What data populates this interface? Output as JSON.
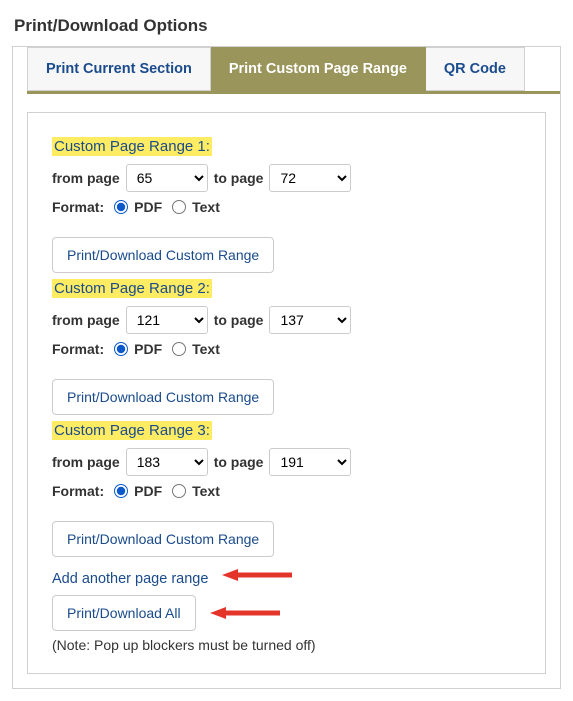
{
  "title": "Print/Download Options",
  "tabs": {
    "current": "Print Current Section",
    "custom": "Print Custom Page Range",
    "qr": "QR Code"
  },
  "ranges": [
    {
      "title": "Custom Page Range 1:",
      "from": "65",
      "to": "72"
    },
    {
      "title": "Custom Page Range 2:",
      "from": "121",
      "to": "137"
    },
    {
      "title": "Custom Page Range 3:",
      "from": "183",
      "to": "191"
    }
  ],
  "labels": {
    "from": "from page",
    "to": "to page",
    "format": "Format:",
    "pdf": "PDF",
    "text": "Text",
    "print_range": "Print/Download Custom Range",
    "add_link": "Add another page range",
    "print_all": "Print/Download All",
    "note": "(Note: Pop up blockers must be turned off)"
  }
}
